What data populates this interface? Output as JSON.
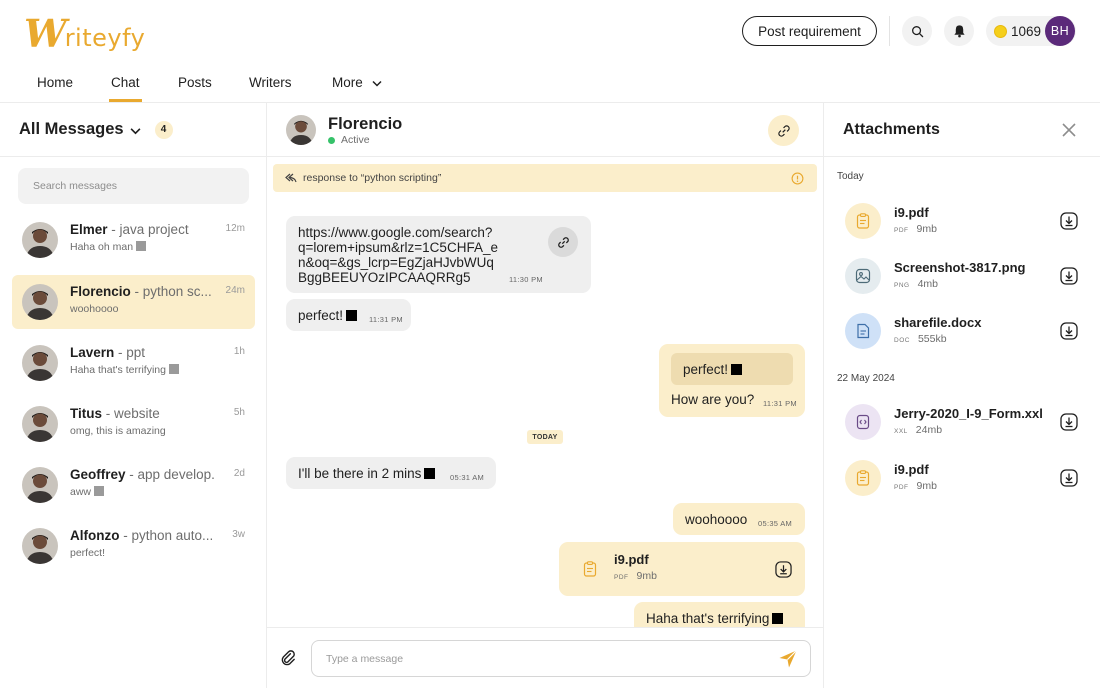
{
  "brand": {
    "logo_w": "W",
    "logo_rest": "riteyfy",
    "accent": "#e9a92f"
  },
  "header": {
    "post_label": "Post requirement",
    "coins": "1069",
    "avatar_initials": "BH"
  },
  "nav": {
    "items": [
      "Home",
      "Chat",
      "Posts",
      "Writers",
      "More"
    ],
    "active": "Chat"
  },
  "left": {
    "title": "All Messages",
    "count": "4",
    "search_placeholder": "Search messages",
    "conversations": [
      {
        "name": "Elmer",
        "topic": " - java project",
        "time": "12m",
        "preview": "Haha oh man"
      },
      {
        "name": "Florencio",
        "topic": " - python sc...",
        "time": "24m",
        "preview": "woohoooo"
      },
      {
        "name": "Lavern",
        "topic": " - ppt",
        "time": "1h",
        "preview": "Haha that's terrifying"
      },
      {
        "name": "Titus",
        "topic": " - website",
        "time": "5h",
        "preview": "omg, this is amazing"
      },
      {
        "name": "Geoffrey",
        "topic": " - app develop...",
        "time": "2d",
        "preview": "aww"
      },
      {
        "name": "Alfonzo",
        "topic": " - python auto...",
        "time": "3w",
        "preview": "perfect!"
      }
    ]
  },
  "chat": {
    "name": "Florencio",
    "status": "Active",
    "reply_to": "response to “python scripting”",
    "messages": {
      "m1_lines": [
        "https://www.google.com/search?",
        "q=lorem+ipsum&rlz=1C5CHFA_e",
        "n&oq=&gs_lcrp=EgZjaHJvbWUq",
        "BggBEEUYOzIPCAAQRRg5"
      ],
      "m1_time": "11:30 PM",
      "m2_text": "perfect!",
      "m2_time": "11:31 PM",
      "m3_quote": "perfect!",
      "m3_text": "How are you?",
      "m3_time": "11:31 PM",
      "day_sep": "TODAY",
      "m4_text": "I'll be there in 2 mins",
      "m4_time": "05:31 AM",
      "m5_text": "woohoooo",
      "m5_time": "05:35 AM",
      "m6_file": "i9.pdf",
      "m6_type": "PDF",
      "m6_size": "9mb",
      "m7_text": "Haha that's terrifying"
    },
    "composer_placeholder": "Type a message"
  },
  "attachments": {
    "title": "Attachments",
    "today_label": "Today",
    "older_label": "22 May 2024",
    "items": [
      {
        "name": "i9.pdf",
        "type": "PDF",
        "size": "9mb"
      },
      {
        "name": "Screenshot-3817.png",
        "type": "PNG",
        "size": "4mb"
      },
      {
        "name": "sharefile.docx",
        "type": "DOC",
        "size": "555kb"
      },
      {
        "name": "Jerry-2020_I-9_Form.xxl",
        "type": "XXL",
        "size": "24mb"
      },
      {
        "name": "i9.pdf",
        "type": "PDF",
        "size": "9mb"
      }
    ]
  }
}
